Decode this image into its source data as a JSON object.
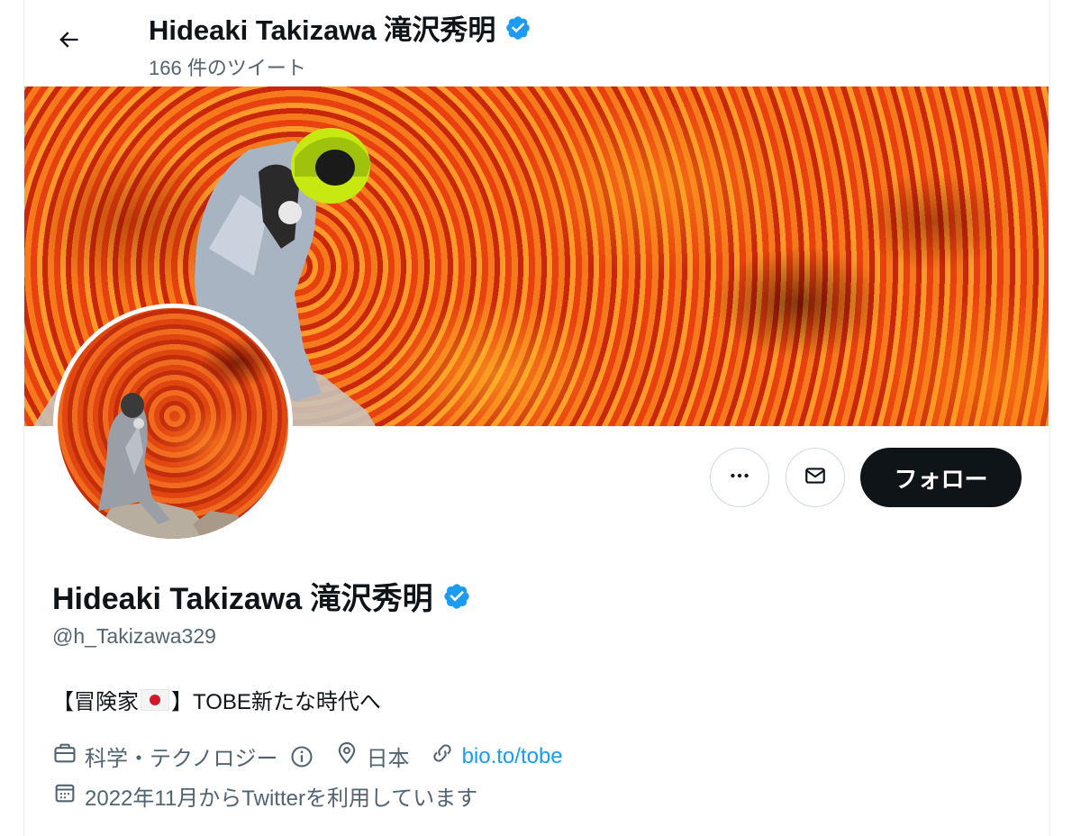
{
  "header": {
    "display_name": "Hideaki Takizawa 滝沢秀明",
    "tweet_count": "166 件のツイート"
  },
  "actions": {
    "follow_label": "フォロー"
  },
  "profile": {
    "display_name": "Hideaki Takizawa 滝沢秀明",
    "handle": "@h_Takizawa329",
    "bio_prefix": "【冒険家",
    "bio_suffix": "】TOBE新たな時代へ",
    "category": "科学・テクノロジー",
    "location": "日本",
    "link": "bio.to/tobe",
    "joined": "2022年11月からTwitterを利用しています"
  },
  "icons": {
    "back": "arrow-left-icon",
    "verified": "verified-badge-icon",
    "more": "more-dots-icon",
    "message": "envelope-icon",
    "category": "briefcase-icon",
    "info": "info-icon",
    "location": "location-pin-icon",
    "link": "link-icon",
    "calendar": "calendar-icon",
    "flag": "japan-flag-icon"
  },
  "colors": {
    "accent": "#1d9bf0",
    "text": "#0f1419",
    "muted": "#536471",
    "follow_bg": "#0f1419"
  }
}
